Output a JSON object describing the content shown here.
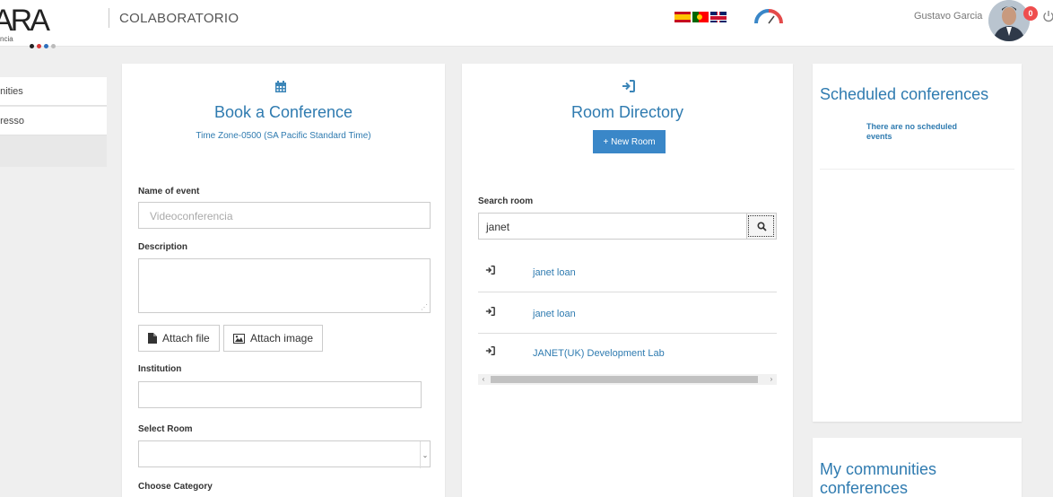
{
  "header": {
    "logo_text": "ARA",
    "logo_subtext": "ncia",
    "app_title": "COLABORATORIO",
    "user_name": "Gustavo Garcia",
    "notification_count": "0",
    "flags": [
      "es",
      "pt",
      "uk"
    ]
  },
  "sidebar": {
    "items": [
      {
        "label": "unities"
      },
      {
        "label": "presso"
      }
    ]
  },
  "book": {
    "icon": "calendar-icon",
    "title": "Book a Conference",
    "timezone": "Time Zone-0500 (SA Pacific Standard Time)",
    "name_label": "Name of event",
    "name_placeholder": "Videoconferencia",
    "description_label": "Description",
    "attach_file": "Attach file",
    "attach_image": "Attach image",
    "institution_label": "Institution",
    "room_label": "Select Room",
    "category_label": "Choose Category"
  },
  "room_directory": {
    "icon": "sign-in-icon",
    "title": "Room Directory",
    "new_room": "+ New Room",
    "search_label": "Search room",
    "search_value": "janet",
    "results": [
      {
        "name": "janet loan"
      },
      {
        "name": "janet loan"
      },
      {
        "name": "JANET(UK) Development Lab"
      }
    ]
  },
  "scheduled": {
    "title": "Scheduled conferences",
    "empty_line1": "There are no scheduled",
    "empty_line2": "events"
  },
  "communities": {
    "title_line1": "My communities",
    "title_line2": "conferences"
  },
  "colors": {
    "accent": "#2f7bb0",
    "button": "#3a87c8",
    "background": "#efefef"
  }
}
